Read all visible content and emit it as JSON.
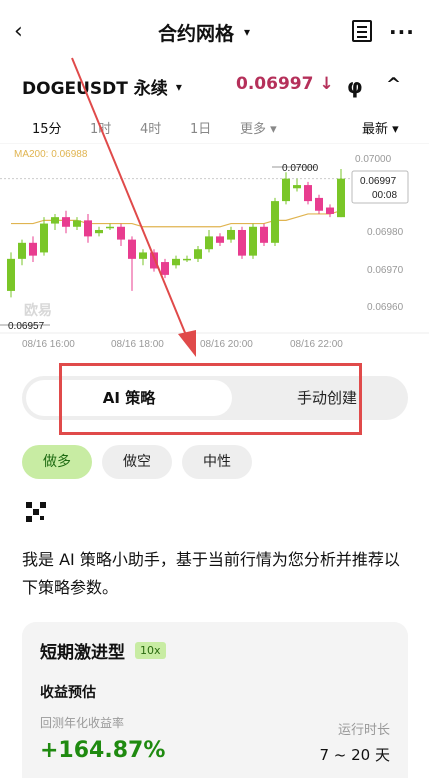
{
  "header": {
    "back_glyph": "‹",
    "title": "合约网格",
    "title_caret": "▾",
    "icons": [
      "back-icon",
      "document-icon",
      "more-icon"
    ],
    "more_glyph": "···"
  },
  "pair": {
    "symbol": "DOGEUSDT 永续",
    "caret": "▾",
    "price": "0.06997",
    "direction_glyph": "↓",
    "kline_glyph": "φ",
    "collapse_glyph": "^"
  },
  "timeframes": {
    "items": [
      "15分",
      "1时",
      "4时",
      "1日"
    ],
    "active": "15分",
    "more": "更多 ▾",
    "latest": "最新 ▾"
  },
  "chart_data": {
    "type": "candlestick",
    "indicator": "MA200: 0.06988",
    "watermark": "欧易",
    "y_ticks": [
      "0.07000",
      "0.06980",
      "0.06970",
      "0.06960"
    ],
    "x_ticks": [
      "08/16 16:00",
      "08/16 18:00",
      "08/16 20:00",
      "08/16 22:00"
    ],
    "high_label": "0.07000",
    "low_label": "0.06957",
    "current_price": "0.06997",
    "countdown": "00:08",
    "ylim": [
      0.06952,
      0.07005
    ],
    "candles": [
      {
        "o": 0.06962,
        "c": 0.06972,
        "h": 0.06974,
        "l": 0.0696
      },
      {
        "o": 0.06972,
        "c": 0.06977,
        "h": 0.06978,
        "l": 0.0697
      },
      {
        "o": 0.06977,
        "c": 0.06973,
        "h": 0.06979,
        "l": 0.06971
      },
      {
        "o": 0.06974,
        "c": 0.06983,
        "h": 0.06985,
        "l": 0.06973
      },
      {
        "o": 0.06983,
        "c": 0.06985,
        "h": 0.06986,
        "l": 0.06981
      },
      {
        "o": 0.06985,
        "c": 0.06982,
        "h": 0.06987,
        "l": 0.0698
      },
      {
        "o": 0.06982,
        "c": 0.06984,
        "h": 0.06985,
        "l": 0.06981
      },
      {
        "o": 0.06984,
        "c": 0.06979,
        "h": 0.06986,
        "l": 0.06977
      },
      {
        "o": 0.0698,
        "c": 0.06981,
        "h": 0.06982,
        "l": 0.06979
      },
      {
        "o": 0.06982,
        "c": 0.06982,
        "h": 0.06983,
        "l": 0.06981
      },
      {
        "o": 0.06982,
        "c": 0.06978,
        "h": 0.06983,
        "l": 0.06976
      },
      {
        "o": 0.06978,
        "c": 0.06972,
        "h": 0.06979,
        "l": 0.06962
      },
      {
        "o": 0.06972,
        "c": 0.06974,
        "h": 0.06975,
        "l": 0.0697
      },
      {
        "o": 0.06974,
        "c": 0.06969,
        "h": 0.06975,
        "l": 0.06968
      },
      {
        "o": 0.06971,
        "c": 0.06967,
        "h": 0.06972,
        "l": 0.06966
      },
      {
        "o": 0.0697,
        "c": 0.06972,
        "h": 0.06973,
        "l": 0.06969
      },
      {
        "o": 0.06972,
        "c": 0.06972,
        "h": 0.06973,
        "l": 0.06971
      },
      {
        "o": 0.06972,
        "c": 0.06975,
        "h": 0.06976,
        "l": 0.06971
      },
      {
        "o": 0.06975,
        "c": 0.06979,
        "h": 0.06981,
        "l": 0.06974
      },
      {
        "o": 0.06979,
        "c": 0.06977,
        "h": 0.0698,
        "l": 0.06976
      },
      {
        "o": 0.06978,
        "c": 0.06981,
        "h": 0.06982,
        "l": 0.06977
      },
      {
        "o": 0.06981,
        "c": 0.06973,
        "h": 0.06982,
        "l": 0.06972
      },
      {
        "o": 0.06973,
        "c": 0.06982,
        "h": 0.06983,
        "l": 0.06972
      },
      {
        "o": 0.06982,
        "c": 0.06977,
        "h": 0.06983,
        "l": 0.06976
      },
      {
        "o": 0.06977,
        "c": 0.0699,
        "h": 0.06991,
        "l": 0.06976
      },
      {
        "o": 0.0699,
        "c": 0.06997,
        "h": 0.06999,
        "l": 0.06989
      },
      {
        "o": 0.06994,
        "c": 0.06995,
        "h": 0.06997,
        "l": 0.06993
      },
      {
        "o": 0.06995,
        "c": 0.0699,
        "h": 0.06996,
        "l": 0.06989
      },
      {
        "o": 0.06991,
        "c": 0.06987,
        "h": 0.06992,
        "l": 0.06986
      },
      {
        "o": 0.06988,
        "c": 0.06986,
        "h": 0.06989,
        "l": 0.06985
      },
      {
        "o": 0.06985,
        "c": 0.06997,
        "h": 0.07,
        "l": 0.06985
      }
    ],
    "ma": [
      0.06983,
      0.06983,
      0.06983,
      0.06984,
      0.06984,
      0.06984,
      0.06984,
      0.06983,
      0.06983,
      0.06983,
      0.06983,
      0.06983,
      0.06982,
      0.06982,
      0.06982,
      0.06982,
      0.06982,
      0.06982,
      0.06982,
      0.06982,
      0.06983,
      0.06983,
      0.06983,
      0.06983,
      0.06984,
      0.06984,
      0.06985,
      0.06986,
      0.06986,
      0.06986,
      0.06987
    ],
    "colors": {
      "up": "#7ac628",
      "down": "#e83c8f",
      "ma": "#e0b450",
      "price": "#b5305a"
    }
  },
  "strategy_tabs": {
    "active": "AI 策略",
    "other": "手动创建"
  },
  "direction_pills": [
    "做多",
    "做空",
    "中性"
  ],
  "assistant_text": "我是 AI 策略小助手，基于当前行情为您分析并推荐以下策略参数。",
  "card": {
    "title": "短期激进型",
    "leverage": "10x",
    "estimate_label": "收益预估",
    "annual_label": "回测年化收益率",
    "annual_value": "+164.87%",
    "runtime_label": "运行时长",
    "runtime_value": "7 ~ 20 天"
  }
}
